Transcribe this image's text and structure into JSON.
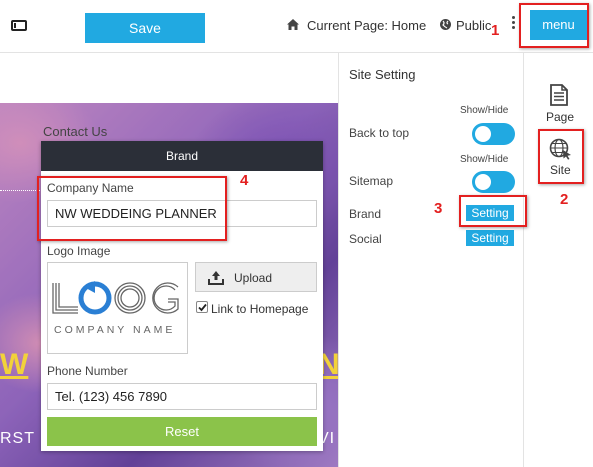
{
  "toolbar": {
    "save_label": "Save",
    "current_page": "Current Page: Home",
    "public_label": "Public",
    "menu_label": "menu",
    "icons": [
      "device-icon",
      "home-icon",
      "globe-icon",
      "more-vert-icon"
    ]
  },
  "preview": {
    "contact_us": "Contact Us",
    "heading_left": "W",
    "heading_right": "N",
    "subtext_left": "RST",
    "subtext_right": "VI"
  },
  "brand_panel": {
    "title": "Brand",
    "company_name_label": "Company Name",
    "company_name_value": "NW WEDDEING PLANNER",
    "logo_image_label": "Logo Image",
    "upload_label": "Upload",
    "link_to_homepage_label": "Link to Homepage",
    "link_to_homepage_checked": true,
    "phone_label": "Phone Number",
    "phone_value": "Tel. (123) 456 7890",
    "reset_label": "Reset",
    "logo": {
      "mark": "LOGO",
      "tagline": "COMPANY NAME"
    }
  },
  "site_setting": {
    "title": "Site Setting",
    "rows": [
      {
        "label": "Back to top",
        "control": "toggle",
        "caption": "Show/Hide",
        "on": true
      },
      {
        "label": "Sitemap",
        "control": "toggle",
        "caption": "Show/Hide",
        "on": true
      },
      {
        "label": "Brand",
        "control": "button",
        "button_label": "Setting"
      },
      {
        "label": "Social",
        "control": "button",
        "button_label": "Setting"
      }
    ]
  },
  "rail": {
    "page_label": "Page",
    "site_label": "Site"
  },
  "annotations": [
    "1",
    "2",
    "3",
    "4"
  ],
  "colors": {
    "accent": "#21a9e1",
    "reset_green": "#8bc34a",
    "annotation_red": "#e32020",
    "panel_header": "#2b2f38"
  }
}
